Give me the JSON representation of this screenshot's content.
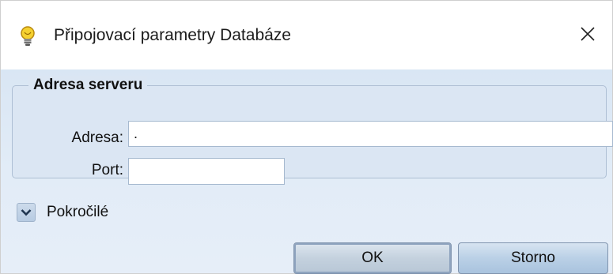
{
  "window": {
    "title": "Připojovací parametry Databáze",
    "title_icon": "lightbulb-icon",
    "close_icon": "close-icon"
  },
  "server_group": {
    "legend": "Adresa serveru",
    "address_label": "Adresa:",
    "address_value": ".",
    "port_label": "Port:",
    "port_value": ""
  },
  "advanced": {
    "label": "Pokročilé",
    "icon": "chevron-down-icon",
    "expanded": false
  },
  "buttons": {
    "ok": "OK",
    "cancel": "Storno"
  },
  "colors": {
    "client_bg": "#dbe6f3",
    "button_ok": "#c4d1de",
    "button_cancel": "#bad0e6"
  }
}
